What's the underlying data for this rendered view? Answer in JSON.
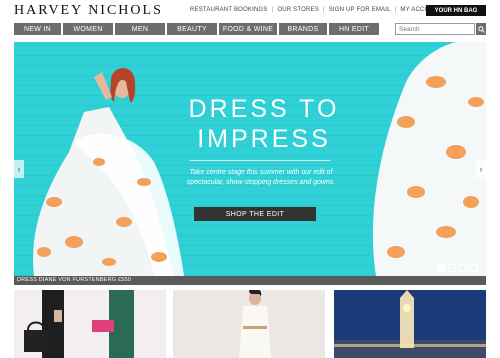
{
  "header": {
    "logo": "HARVEY NICHOLS",
    "links": [
      "RESTAURANT BOOKINGS",
      "OUR STORES",
      "SIGN UP FOR EMAIL",
      "MY ACCOUNT"
    ],
    "bag_label": "YOUR HN BAG"
  },
  "nav": {
    "items": [
      "NEW IN",
      "WOMEN",
      "MEN",
      "BEAUTY",
      "FOOD & WINE",
      "BRANDS",
      "HN EDIT"
    ],
    "search_placeholder": "Search"
  },
  "hero": {
    "headline_line1": "DRESS TO",
    "headline_line2": "IMPRESS",
    "subtext": "Take centre stage this summer with our edit of spectacular, show-stopping dresses and gowns.",
    "cta_label": "SHOP THE EDIT",
    "caption": "DRESS DIANE VON FURSTENBERG £550",
    "slide_count": 4,
    "active_slide": 1
  },
  "colors": {
    "hero_bg": "#2fd1d7",
    "nav_bg": "#6d6d6d",
    "dress_orange": "#f2a05a"
  }
}
